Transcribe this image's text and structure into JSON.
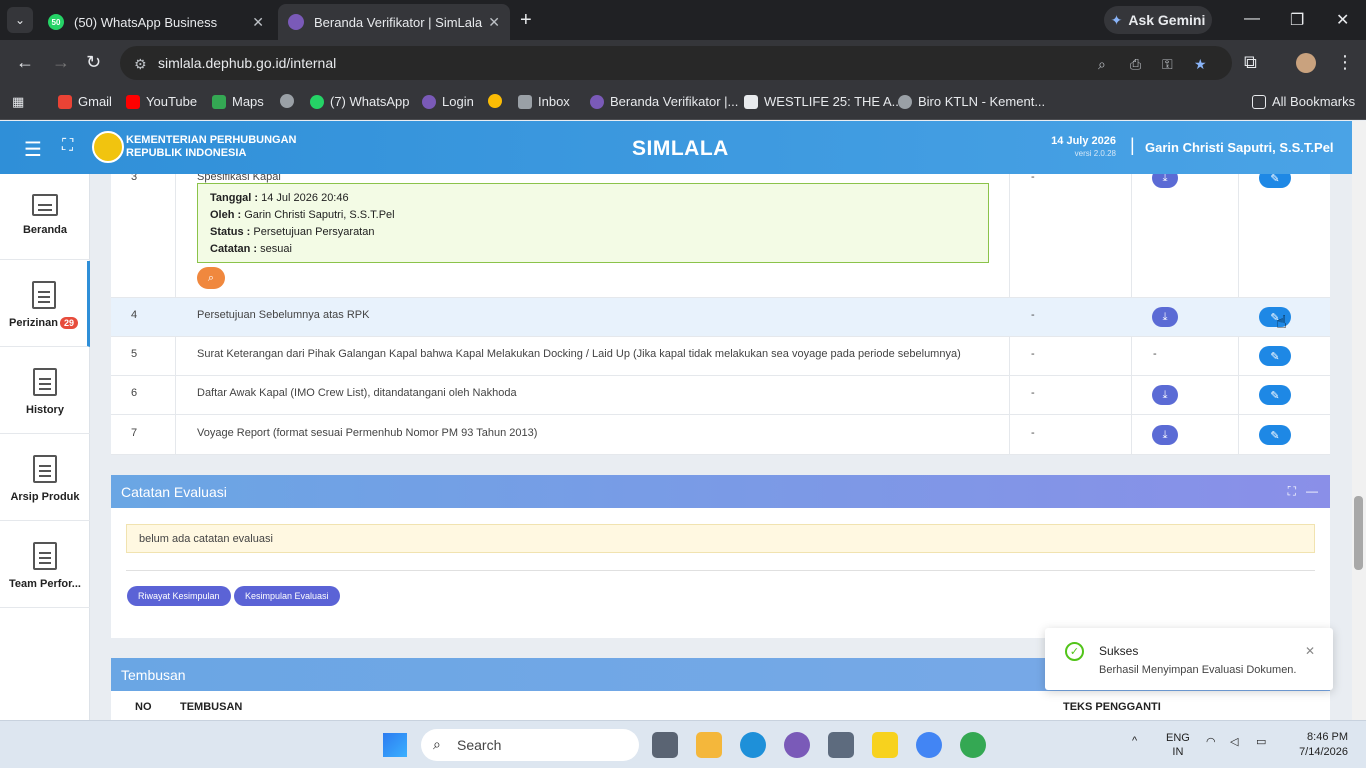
{
  "browser": {
    "tabs": [
      {
        "title": "(50) WhatsApp Business",
        "favicon_text": "50"
      },
      {
        "title": "Beranda Verifikator | SimLala"
      }
    ],
    "ask_gemini": "Ask Gemini",
    "url": "simlala.dephub.go.id/internal",
    "bookmarks": [
      "Gmail",
      "YouTube",
      "Maps",
      "(7) WhatsApp",
      "Login",
      "Inbox",
      "Beranda Verifikator |...",
      "WESTLIFE 25: THE A...",
      "Biro KTLN - Kement..."
    ],
    "whatsapp_count": "50",
    "all_bookmarks": "All Bookmarks"
  },
  "app": {
    "ministry_line1": "KEMENTERIAN PERHUBUNGAN",
    "ministry_line2": "REPUBLIK INDONESIA",
    "title": "SIMLALA",
    "date": "14 July 2026",
    "version": "versi 2.0.28",
    "user": "Garin Christi Saputri, S.S.T.Pel"
  },
  "sidebar": [
    {
      "label": "Beranda"
    },
    {
      "label": "Perizinan",
      "badge": "29"
    },
    {
      "label": "History"
    },
    {
      "label": "Arsip Produk"
    },
    {
      "label": "Team Perfor..."
    }
  ],
  "documents": {
    "partial_row": {
      "num": "3",
      "name": "Spesifikasi Kapal",
      "dash": "-"
    },
    "note": {
      "tanggal_label": "Tanggal :",
      "tanggal": "14 Jul 2026 20:46",
      "oleh_label": "Oleh :",
      "oleh": "Garin Christi Saputri, S.S.T.Pel",
      "status_label": "Status :",
      "status": "Persetujuan Persyaratan",
      "catatan_label": "Catatan :",
      "catatan": "sesuai"
    },
    "rows": [
      {
        "num": "4",
        "name": "Persetujuan Sebelumnya atas RPK",
        "col3": "-",
        "col4": ""
      },
      {
        "num": "5",
        "name": "Surat Keterangan dari Pihak Galangan Kapal bahwa Kapal Melakukan Docking / Laid Up (Jika kapal tidak melakukan sea voyage pada periode sebelumnya)",
        "col3": "-",
        "col4": "-"
      },
      {
        "num": "6",
        "name": "Daftar Awak Kapal (IMO Crew List), ditandatangani oleh Nakhoda",
        "col3": "-",
        "col4": ""
      },
      {
        "num": "7",
        "name": "Voyage Report (format sesuai Permenhub Nomor PM 93 Tahun 2013)",
        "col3": "-",
        "col4": ""
      }
    ]
  },
  "catatan": {
    "title": "Catatan Evaluasi",
    "alert": "belum ada catatan evaluasi",
    "btn_riwayat": "Riwayat Kesimpulan",
    "btn_kesimpulan": "Kesimpulan Evaluasi"
  },
  "tembusan": {
    "title": "Tembusan",
    "col_no": "NO",
    "col_tembusan": "TEMBUSAN",
    "col_teks": "TEKS PENGGANTI"
  },
  "toast": {
    "title": "Sukses",
    "message": "Berhasil Menyimpan Evaluasi Dokumen."
  },
  "taskbar": {
    "search": "Search",
    "lang1": "ENG",
    "lang2": "IN",
    "time": "8:46 PM",
    "date": "7/14/2026"
  }
}
